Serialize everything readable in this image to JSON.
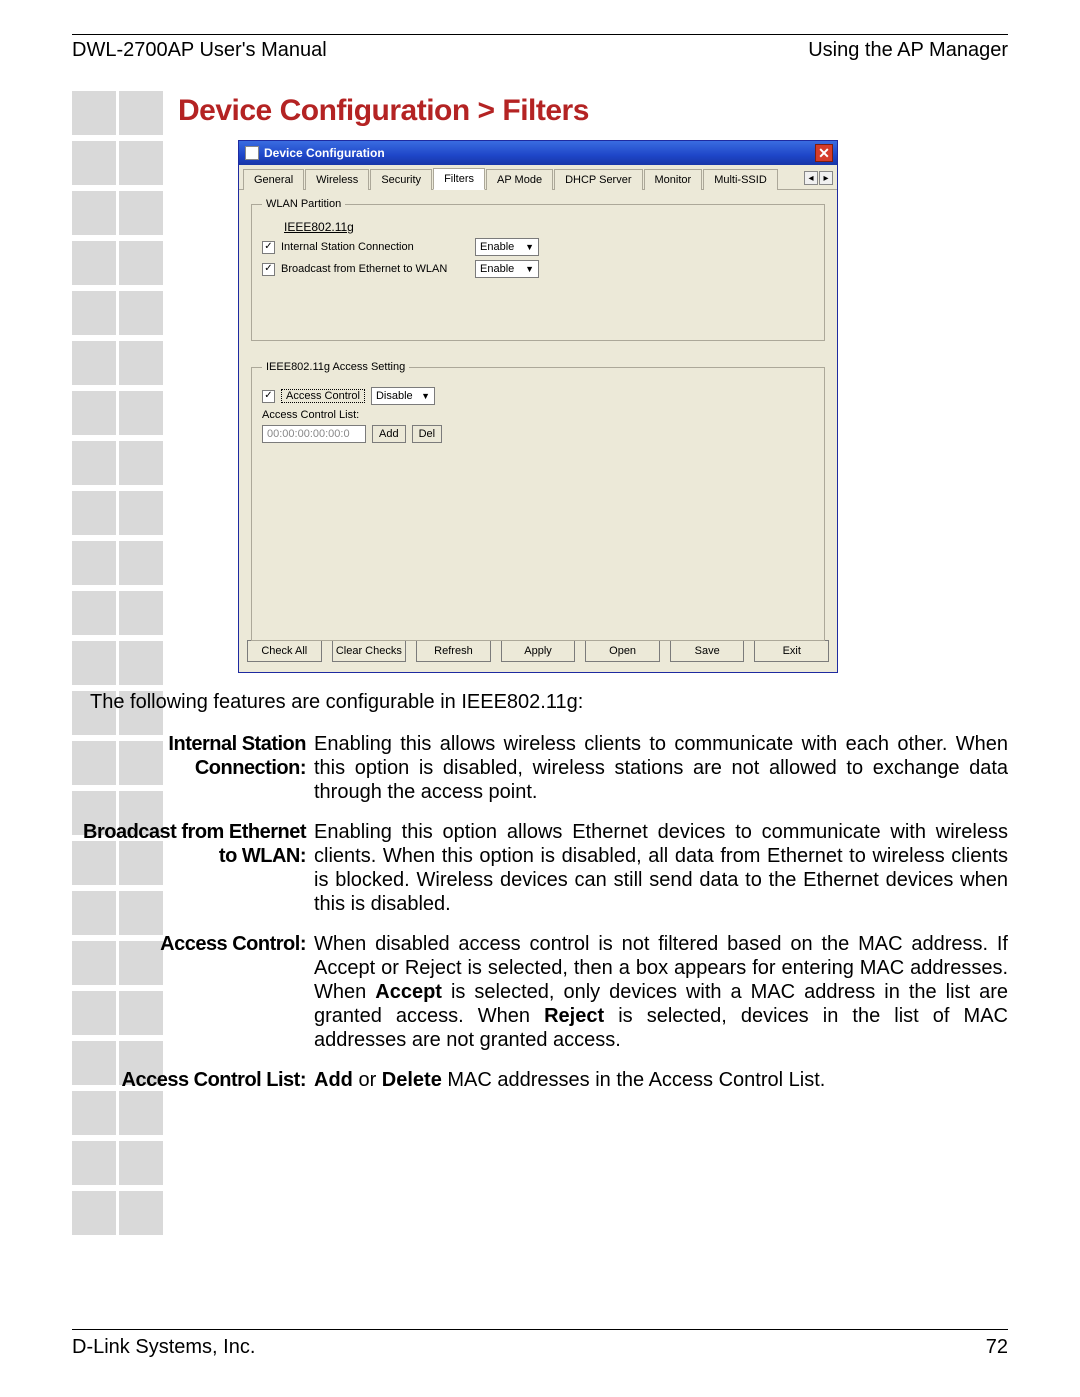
{
  "header": {
    "left": "DWL-2700AP User's Manual",
    "right": "Using the AP Manager"
  },
  "footer": {
    "left": "D-Link Systems, Inc.",
    "right": "72"
  },
  "title": "Device Configuration > Filters",
  "dialog": {
    "title": "Device Configuration",
    "tabs": [
      "General",
      "Wireless",
      "Security",
      "Filters",
      "AP Mode",
      "DHCP Server",
      "Monitor",
      "Multi-SSID"
    ],
    "active_tab": 3,
    "wlan_legend": "WLAN Partition",
    "wlan_sublabel": "IEEE802.11g",
    "internal_station": {
      "checked": true,
      "label": "Internal Station Connection",
      "select": "Enable"
    },
    "broadcast": {
      "checked": true,
      "label": "Broadcast from Ethernet to WLAN",
      "select": "Enable"
    },
    "access_legend": "IEEE802.11g Access Setting",
    "access_control": {
      "checked": true,
      "label": "Access Control",
      "select": "Disable"
    },
    "acl_label": "Access Control List:",
    "mac_placeholder": "00:00:00:00:00:0",
    "add": "Add",
    "del": "Del",
    "buttons": [
      "Check All",
      "Clear Checks",
      "Refresh",
      "Apply",
      "Open",
      "Save",
      "Exit"
    ]
  },
  "intro": "The following features are configurable in IEEE802.11g:",
  "defs": {
    "isc_label": "Internal Station Connection:",
    "isc_body": "Enabling this allows wireless clients to communicate with each other. When this option is disabled, wireless stations are not allowed to exchange data through the access point.",
    "bcast_label": "Broadcast from Ethernet to WLAN:",
    "bcast_body": "Enabling this option allows Ethernet devices to communicate with wireless clients. When this option is disabled, all data from Ethernet to wireless clients is blocked. Wireless devices can still send data to the Ethernet devices when this is disabled.",
    "ac_label": "Access Control:",
    "ac_pre": "When disabled access control is not filtered based on the MAC address. If Accept or Reject is selected, then a box appears for entering MAC addresses. When ",
    "ac_accept": "Accept",
    "ac_mid": " is selected, only devices with a MAC address in the list are granted access. When ",
    "ac_reject": "Reject",
    "ac_post": " is selected, devices in the list of MAC addresses are not granted access.",
    "acl_label2": "Access Control List:",
    "acl_add": "Add",
    "acl_or": " or ",
    "acl_del": "Delete",
    "acl_rest": " MAC addresses in the Access Control List."
  }
}
